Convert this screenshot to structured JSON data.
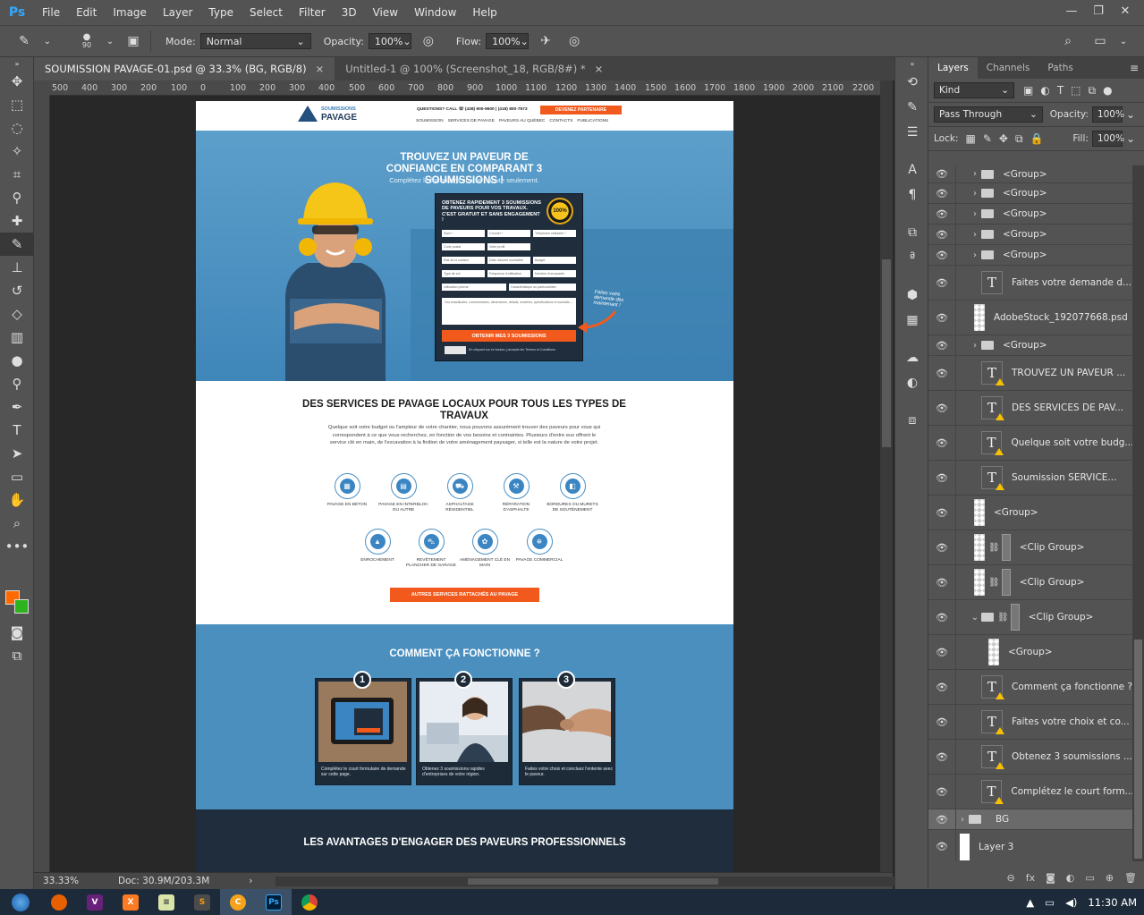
{
  "app": {
    "logo": "Ps",
    "menu": [
      "File",
      "Edit",
      "Image",
      "Layer",
      "Type",
      "Select",
      "Filter",
      "3D",
      "View",
      "Window",
      "Help"
    ],
    "window_controls": [
      "—",
      "❐",
      "✕"
    ]
  },
  "options_bar": {
    "brush_size": "90",
    "mode_label": "Mode:",
    "mode_value": "Normal",
    "opacity_label": "Opacity:",
    "opacity_value": "100%",
    "flow_label": "Flow:",
    "flow_value": "100%"
  },
  "tabs": [
    {
      "title": "SOUMISSION PAVAGE-01.psd @ 33.3% (BG, RGB/8)",
      "close": "×"
    },
    {
      "title": "Untitled-1 @ 100% (Screenshot_18, RGB/8#) *",
      "close": "×"
    }
  ],
  "ruler_h": [
    "500",
    "400",
    "300",
    "200",
    "100",
    "0",
    "100",
    "200",
    "300",
    "400",
    "500",
    "600",
    "700",
    "800",
    "900",
    "1000",
    "1100",
    "1200",
    "1300",
    "1400",
    "1500",
    "1600",
    "1700",
    "1800",
    "1900",
    "2000",
    "2100",
    "2200"
  ],
  "status": {
    "zoom": "33.33%",
    "doc": "Doc: 30.9M/203.3M",
    "arrow": "›"
  },
  "colors": {
    "foreground": "#ff6a00",
    "background": "#2db31e",
    "accent_orange": "#f25a1d",
    "brand_blue": "#4b8fbf",
    "dark_navy": "#1f2d3d"
  },
  "doc": {
    "logo_small": "SOUMISSIONS",
    "logo_big": "PAVAGE",
    "topline": "QUESTIONS? CALL   ☏ (438) 900-9600 | (418) 800-7573",
    "cta_top": "DEVENEZ PARTENAIRE",
    "nav": [
      "SOUMISSION",
      "SERVICES DE PAVAGE",
      "PAVEURS AU QUÉBEC",
      "CONTACTS",
      "PUBLICATIONS"
    ],
    "hero_title": "TROUVEZ UN PAVEUR DE CONFIANCE EN COMPARANT 3 SOUMISSIONS !",
    "hero_sub": "Complétez le formulaire en une minute seulement.",
    "form_title": "OBTENEZ RAPIDEMENT 3 SOUMISSIONS DE PAVEURS POUR VOS TRAVAUX. C'EST GRATUIT ET SANS ENGAGEMENT !",
    "form_seal": "100%",
    "form_fields": [
      "Nom *",
      "Courriel *",
      "Téléphone cellulaire *",
      "Code postal",
      "Votre profil",
      "",
      "Etat de la surface",
      "Date d'année souhaitée",
      "Budget",
      "Type de sol",
      "Fréquence d'utilisation",
      "Nombre d'occupants",
      "Utilisation prévue",
      "",
      "Caractéristique ou particularités"
    ],
    "form_textarea": "Vos exactitudes, commentaires, dimensions, détails, modèles, spécifications et souhaits...",
    "form_submit": "OBTENIR MES 3 SOUMISSIONS",
    "form_disclaimer": "En cliquant sur ce bouton, j'accepte les Termes et Conditions",
    "hero_note": "Faites votre demande dès maintenant !",
    "svc_title": "DES SERVICES DE PAVAGE LOCAUX POUR TOUS LES TYPES DE TRAVAUX",
    "svc_desc": "Quelque soit votre budget ou l'ampleur de votre chantier, nous pouvons assurément trouver des paveurs pour vous qui correspondent à ce que vous recherchez, en fonction de vos besoins et contraintes. Plusieurs d'entre eux offrent le service clé en main, de l'excavation à la finition de votre aménagement paysager, si telle est la nature de votre projet.",
    "services": [
      {
        "label": "PAVAGE EN BÉTON",
        "icon": "▦"
      },
      {
        "label": "PAVAGE EN INTERBLOC OU AUTRE",
        "icon": "▤"
      },
      {
        "label": "ASPHALTAGE RÉSIDENTIEL",
        "icon": "⛟"
      },
      {
        "label": "RÉPARATION D'ASPHALTE",
        "icon": "⚒"
      },
      {
        "label": "BORDURES OU MURETS DE SOUTÈNEMENT",
        "icon": "◧"
      },
      {
        "label": "ENROCHEMENT",
        "icon": "▲"
      },
      {
        "label": "REVÊTEMENT PLANCHER DE GARAGE",
        "icon": "⛍"
      },
      {
        "label": "AMÉNAGEMENT CLÉ EN MAIN",
        "icon": "✿"
      },
      {
        "label": "PAVAGE COMMERCIAL",
        "icon": "⛯"
      }
    ],
    "svc_btn": "AUTRES SERVICES RATTACHÉS AU PAVAGE",
    "how_title": "COMMENT ÇA FONCTIONNE ?",
    "how_steps": [
      {
        "num": "1",
        "text": "Complétez le court formulaire de demande sur cette page."
      },
      {
        "num": "2",
        "text": "Obtenez 3 soumissions rapides d'entreprises de votre région."
      },
      {
        "num": "3",
        "text": "Faites votre choix et concluez l'entente avec le paveur."
      }
    ],
    "adv_title": "LES AVANTAGES D'ENGAGER DES PAVEURS PROFESSIONNELS"
  },
  "layers_panel": {
    "tabs": [
      "Layers",
      "Channels",
      "Paths"
    ],
    "menu": "≡",
    "filter_kind": "Kind",
    "blend_mode": "Pass Through",
    "opacity_label": "Opacity:",
    "opacity_value": "100%",
    "lock_label": "Lock:",
    "fill_label": "Fill:",
    "fill_value": "100%",
    "layers": [
      {
        "name": "<Group>",
        "kind": "group"
      },
      {
        "name": "<Group>",
        "kind": "group"
      },
      {
        "name": "<Group>",
        "kind": "group"
      },
      {
        "name": "<Group>",
        "kind": "group"
      },
      {
        "name": "<Group>",
        "kind": "group"
      },
      {
        "name": "Faites votre demande d...",
        "kind": "text"
      },
      {
        "name": "AdobeStock_192077668.psd",
        "kind": "image"
      },
      {
        "name": "<Group>",
        "kind": "group"
      },
      {
        "name": "TROUVEZ UN PAVEUR ...",
        "kind": "text"
      },
      {
        "name": "DES SERVICES DE PAV...",
        "kind": "text"
      },
      {
        "name": "Quelque soit votre budg...",
        "kind": "text"
      },
      {
        "name": "Soumission    SERVICE...",
        "kind": "text"
      },
      {
        "name": "<Group>",
        "kind": "image"
      },
      {
        "name": "<Clip Group>",
        "kind": "clip"
      },
      {
        "name": "<Clip Group>",
        "kind": "clip"
      },
      {
        "name": "<Clip Group>",
        "kind": "clipfolder"
      },
      {
        "name": "<Group>",
        "kind": "image-indent"
      },
      {
        "name": "Comment ça fonctionne ?",
        "kind": "text"
      },
      {
        "name": "Faites votre choix et co...",
        "kind": "text"
      },
      {
        "name": "Obtenez 3 soumissions ...",
        "kind": "text"
      },
      {
        "name": "Complétez le court form...",
        "kind": "text"
      },
      {
        "name": "BG",
        "kind": "bg"
      },
      {
        "name": "Layer 3",
        "kind": "white"
      }
    ],
    "bottom_icons": [
      "⊖",
      "fx",
      "◙",
      "◐",
      "▭",
      "⊕",
      "🗑"
    ]
  },
  "taskbar": {
    "time": "11:30 AM"
  }
}
